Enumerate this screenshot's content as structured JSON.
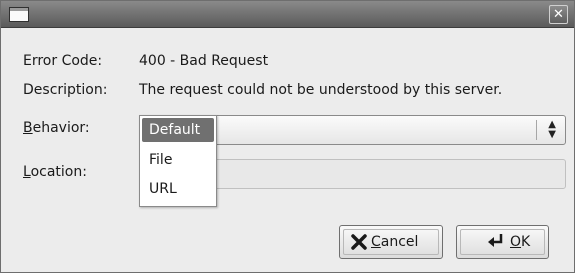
{
  "window": {
    "title": "",
    "close_glyph": "✕"
  },
  "fields": {
    "error_code": {
      "label": "Error Code:",
      "value": "400 - Bad Request"
    },
    "description": {
      "label": "Description:",
      "value": "The request could not be understood by this server."
    },
    "behavior": {
      "label_mnemonic": "B",
      "label_rest": "ehavior:",
      "selected": "Default",
      "options": [
        "Default",
        "File",
        "URL"
      ]
    },
    "location": {
      "label_mnemonic": "L",
      "label_rest": "ocation:",
      "value": ""
    }
  },
  "buttons": {
    "cancel": {
      "mnemonic": "C",
      "rest": "ancel",
      "icon": "cancel-x-icon"
    },
    "ok": {
      "mnemonic": "O",
      "rest": "K",
      "icon": "ok-arrow-icon"
    }
  },
  "colors": {
    "titlebar": "#6e6e6e",
    "dialog_bg": "#ececec",
    "selection": "#707070"
  }
}
